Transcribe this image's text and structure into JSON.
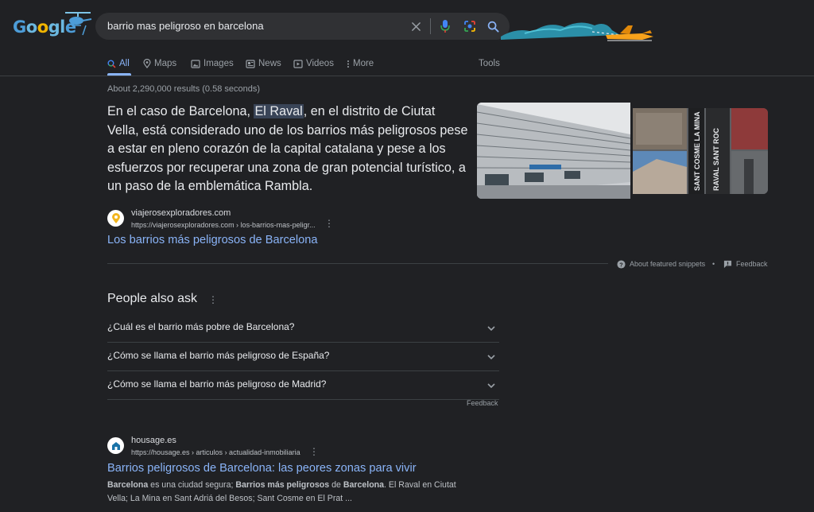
{
  "search": {
    "query": "barrio mas peligroso en barcelona"
  },
  "logo": {
    "text": "Google"
  },
  "tabs": [
    {
      "label": "All",
      "icon": "search-icon",
      "active": true
    },
    {
      "label": "Maps",
      "icon": "map-pin-icon"
    },
    {
      "label": "Images",
      "icon": "image-icon"
    },
    {
      "label": "News",
      "icon": "news-icon"
    },
    {
      "label": "Videos",
      "icon": "video-icon"
    },
    {
      "label": "More",
      "icon": "more-vert-icon"
    }
  ],
  "tools_label": "Tools",
  "stats": "About 2,290,000 results (0.58 seconds)",
  "featured_snippet": {
    "text_before": "En el caso de Barcelona, ",
    "highlight": "El Raval",
    "text_after": ", en el distrito de Ciutat Vella, está considerado uno de los barrios más peligrosos pese a estar en pleno corazón de la capital catalana y pese a los esfuerzos por recuperar una zona de gran potencial turístico, a un paso de la emblemática Rambla.",
    "source_name": "viajerosexploradores.com",
    "source_url": "https://viajerosexploradores.com › los-barrios-mas-peligr...",
    "title": "Los barrios más peligrosos de Barcelona",
    "image_texts": [
      "SANT COSME LA MINA",
      "RAVAL SANT ROC"
    ],
    "about_label": "About featured snippets",
    "feedback_label": "Feedback"
  },
  "people_also_ask": {
    "title": "People also ask",
    "questions": [
      "¿Cuál es el barrio más pobre de Barcelona?",
      "¿Cómo se llama el barrio más peligroso de España?",
      "¿Cómo se llama el barrio más peligroso de Madrid?"
    ],
    "feedback_label": "Feedback"
  },
  "result2": {
    "source_name": "housage.es",
    "source_url": "https://housage.es › articulos › actualidad-inmobiliaria",
    "title": "Barrios peligrosos de Barcelona: las peores zonas para vivir",
    "desc": {
      "b1": "Barcelona",
      "t1": " es una ciudad segura; ",
      "b2": "Barrios más peligrosos",
      "t2": " de ",
      "b3": "Barcelona",
      "t3": ". El Raval en Ciutat Vella; La Mina en Sant Adriá del Besos; Sant Cosme en El Prat ..."
    }
  },
  "colors": {
    "background": "#202124",
    "link": "#8ab4f8",
    "text": "#e8eaed",
    "muted": "#9aa0a6"
  }
}
